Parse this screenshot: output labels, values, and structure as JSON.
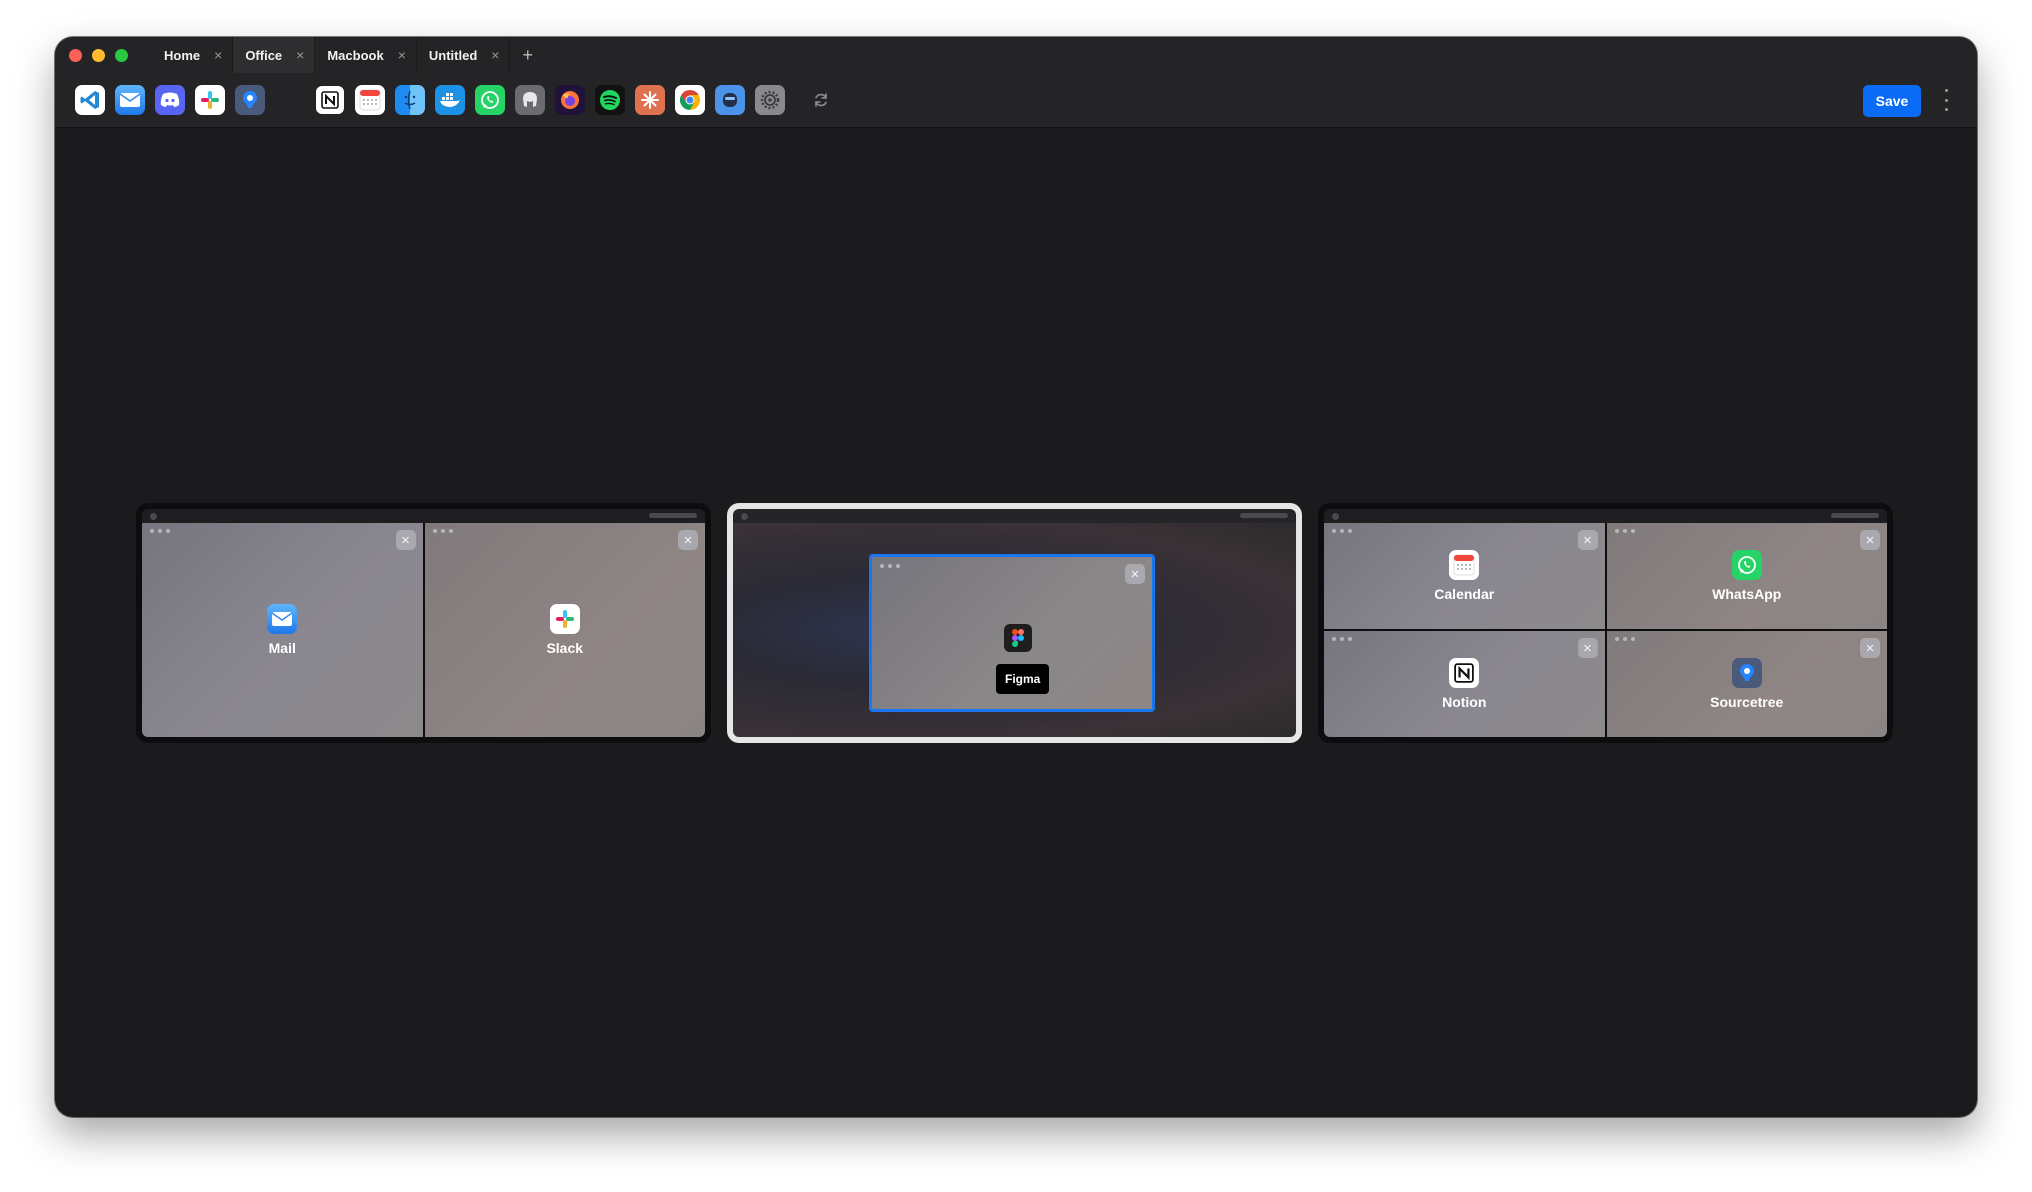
{
  "window": {
    "tabs": [
      {
        "label": "Home",
        "close": "×"
      },
      {
        "label": "Office",
        "close": "×"
      },
      {
        "label": "Macbook",
        "close": "×"
      },
      {
        "label": "Untitled",
        "close": "×"
      }
    ],
    "add_tab": "+"
  },
  "toolbar": {
    "dock_icons": [
      "vscode-icon",
      "mail-icon",
      "discord-icon",
      "slack-icon",
      "sourcetree-icon",
      "notion-icon",
      "calendar-icon",
      "finder-icon",
      "docker-icon",
      "whatsapp-icon",
      "tableplus-icon",
      "firefox-icon",
      "spotify-icon",
      "claude-icon",
      "chrome-icon",
      "codeedit-icon",
      "settings-icon"
    ],
    "refresh_icon": "refresh-icon",
    "save_label": "Save",
    "more_icon": "more-vertical-icon"
  },
  "desktops": {
    "left": {
      "panes": [
        {
          "label": "Mail",
          "icon": "mail-icon"
        },
        {
          "label": "Slack",
          "icon": "slack-icon"
        }
      ]
    },
    "center": {
      "selected": true,
      "window": {
        "label": "Figma",
        "icon": "figma-icon"
      }
    },
    "right": {
      "panes": [
        {
          "label": "Calendar",
          "icon": "calendar-icon"
        },
        {
          "label": "WhatsApp",
          "icon": "whatsapp-icon"
        },
        {
          "label": "Notion",
          "icon": "notion-icon"
        },
        {
          "label": "Sourcetree",
          "icon": "sourcetree-icon"
        }
      ]
    },
    "close_glyph": "×"
  },
  "colors": {
    "accent": "#0a6cf5",
    "selection_border": "#1a76f0",
    "window_bg": "#1b1b1d"
  }
}
